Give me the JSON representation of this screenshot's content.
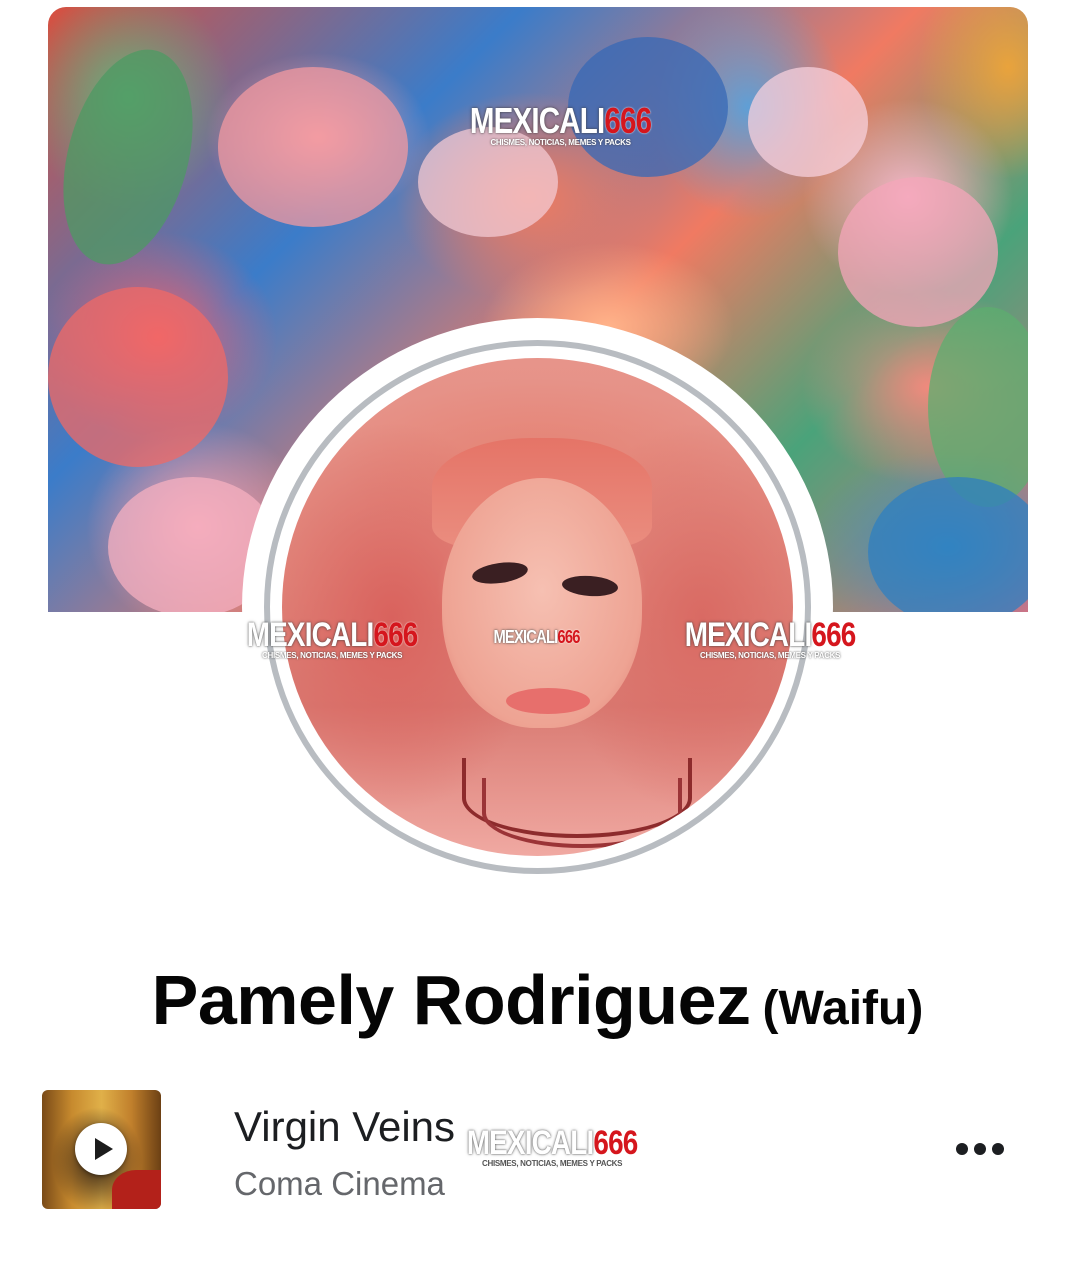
{
  "cover": {
    "alt": "cover-photo"
  },
  "watermarks": [
    {
      "brand": "MEXICALI",
      "number": "666",
      "tagline": "CHISMES, NOTICIAS, MEMES Y PACKS"
    }
  ],
  "profile": {
    "name": "Pamely Rodriguez",
    "alternate_name": "(Waifu)"
  },
  "music": {
    "song_title": "Virgin Veins",
    "artist": "Coma Cinema"
  },
  "icons": [
    "play-icon",
    "more-options-icon"
  ]
}
